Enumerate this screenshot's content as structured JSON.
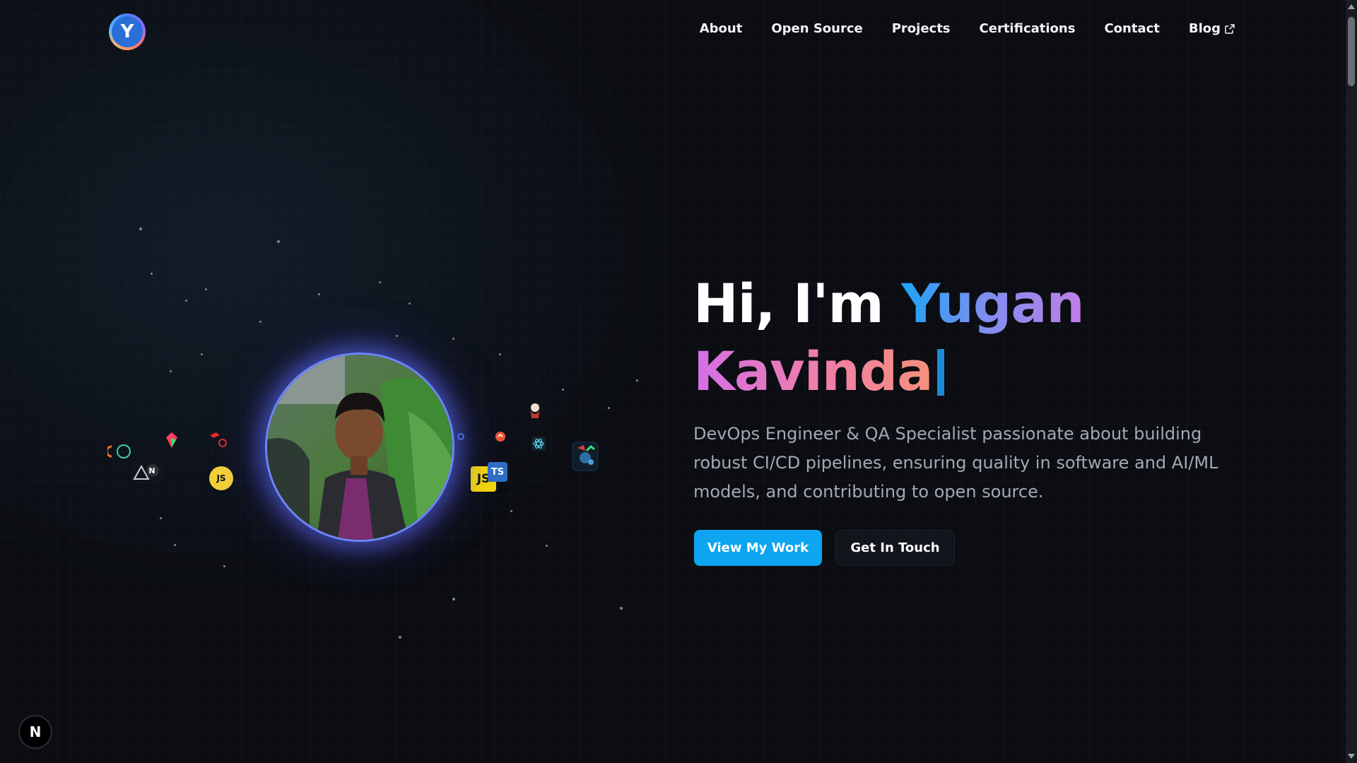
{
  "header": {
    "logo_letter": "Y",
    "nav": {
      "about": "About",
      "open_source": "Open Source",
      "projects": "Projects",
      "certifications": "Certifications",
      "contact": "Contact",
      "blog": "Blog"
    }
  },
  "hero": {
    "greeting": "Hi, I'm",
    "first_name": "Yugan",
    "last_name": "Kavinda",
    "description": "DevOps Engineer & QA Specialist passionate about building robust CI/CD pipelines, ensuring quality in software and AI/ML models, and contributing to open source.",
    "primary_button": "View My Work",
    "secondary_button": "Get In Touch"
  },
  "floating_icons": {
    "js_badge": "JS",
    "ts_badge": "TS",
    "node_badge": "N"
  },
  "dev_badge": "N",
  "colors": {
    "accent": "#0ea5f0",
    "background": "#0b0d12",
    "name_gradient_start": "#1ca3f6",
    "name_gradient_end": "#f6907a"
  }
}
